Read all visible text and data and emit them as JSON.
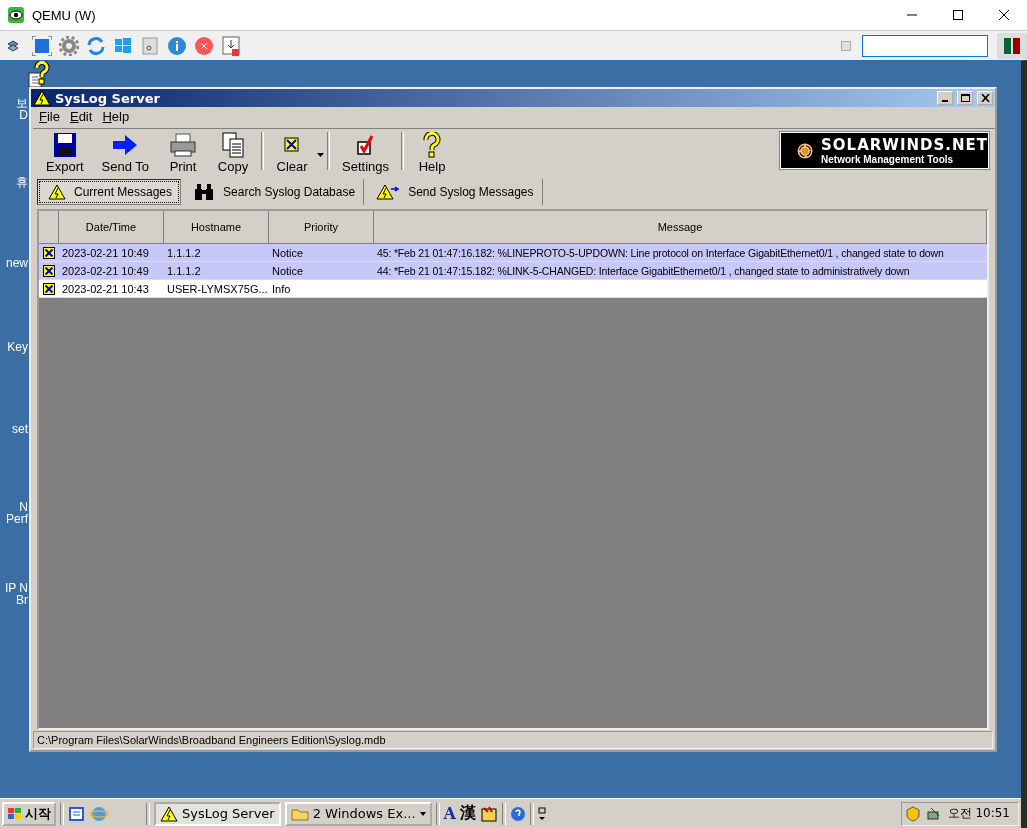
{
  "qemu": {
    "title": "QEMU (W)",
    "checkbox": {
      "checked": false
    }
  },
  "desktop_icons": [
    {
      "lines": [
        "보",
        "D"
      ]
    },
    {
      "lines": [
        "휴"
      ]
    },
    {
      "lines": [
        "new"
      ]
    },
    {
      "lines": [
        "Key"
      ]
    },
    {
      "lines": [
        "set"
      ]
    },
    {
      "lines": [
        "N",
        "Perf"
      ]
    },
    {
      "lines": [
        "IP N",
        "Br"
      ]
    }
  ],
  "syslog": {
    "title": "SysLog Server",
    "menu": [
      "File",
      "Edit",
      "Help"
    ],
    "toolbar": [
      {
        "label": "Export",
        "kind": "disk"
      },
      {
        "label": "Send To",
        "kind": "arrow"
      },
      {
        "label": "Print",
        "kind": "printer"
      },
      {
        "label": "Copy",
        "kind": "copy"
      },
      {
        "label": "Clear",
        "kind": "clear"
      },
      {
        "label": "Settings",
        "kind": "settings"
      },
      {
        "label": "Help",
        "kind": "help"
      }
    ],
    "logo": {
      "name": "SOLARWINDS.NET",
      "tagline": "Network Management Tools"
    },
    "tabs": [
      {
        "label": "Current Messages",
        "kind": "warning",
        "selected": true
      },
      {
        "label": "Search Syslog Database",
        "kind": "binoculars",
        "selected": false
      },
      {
        "label": "Send Syslog Messages",
        "kind": "send",
        "selected": false
      }
    ],
    "table": {
      "columns": [
        "Date/Time",
        "Hostname",
        "Priority",
        "Message"
      ],
      "rows": [
        {
          "selected": true,
          "cells": [
            "2023-02-21 10:49",
            "1.1.1.2",
            "Notice",
            "45: *Feb 21 01:47:16.182: %LINEPROTO-5-UPDOWN: Line protocol on Interface GigabitEthernet0/1 , changed state to down"
          ]
        },
        {
          "selected": true,
          "cells": [
            "2023-02-21 10:49",
            "1.1.1.2",
            "Notice",
            "44: *Feb 21 01:47:15.182: %LINK-5-CHANGED: Interface GigabitEthernet0/1 , changed state to administratively down"
          ]
        },
        {
          "selected": false,
          "cells": [
            "2023-02-21 10:43",
            "USER-LYMSX75G...",
            "Info",
            ""
          ]
        }
      ]
    },
    "status": "C:\\Program Files\\SolarWinds\\Broadband Engineers Edition\\Syslog.mdb"
  },
  "taskbar": {
    "start": "시작",
    "tasks": [
      {
        "label": "SysLog Server",
        "kind": "warning",
        "selected": true
      },
      {
        "label": "2 Windows Ex...",
        "kind": "folder",
        "selected": false
      }
    ],
    "ime": [
      "A",
      "漢"
    ],
    "clock": "오전 10:51"
  }
}
